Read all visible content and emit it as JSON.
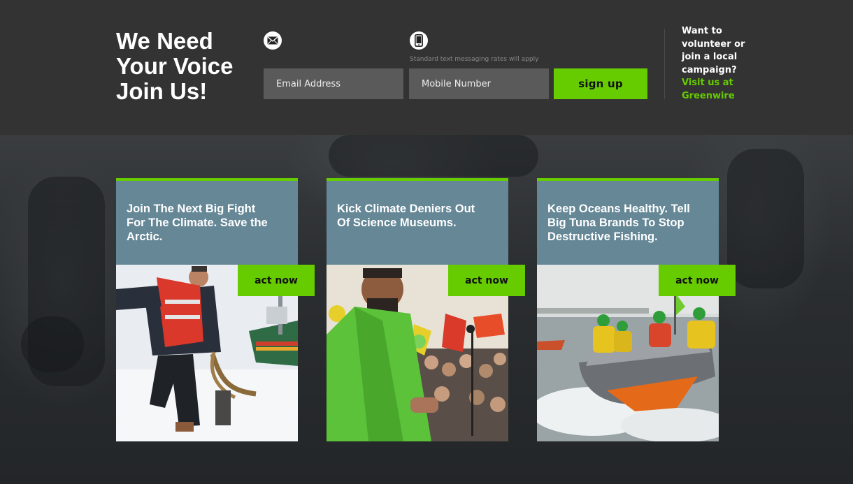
{
  "header": {
    "headline": [
      "We Need",
      "Your Voice",
      "Join Us!"
    ],
    "sms_note": "Standard text messaging rates will apply",
    "email_placeholder": "Email Address",
    "mobile_placeholder": "Mobile Number",
    "signup_label": "sign up",
    "email_icon": "envelope-icon",
    "phone_icon": "mobile-phone-icon"
  },
  "volunteer": {
    "lines": [
      "Want to",
      "volunteer or",
      "join a local",
      "campaign?"
    ],
    "link_lines": [
      "Visit us at",
      "Greenwire"
    ]
  },
  "cards": [
    {
      "title_lines": [
        "Join The Next Big Fight",
        "For The Climate. Save the",
        "Arctic."
      ],
      "cta": "act now",
      "image": "arctic-activist-on-ice-photo"
    },
    {
      "title_lines": [
        "Kick Climate Deniers Out",
        "Of Science Museums."
      ],
      "cta": "act now",
      "image": "speaker-at-climate-march-photo"
    },
    {
      "title_lines": [
        "Keep Oceans Healthy. Tell",
        "Big Tuna Brands To Stop",
        "Destructive Fishing."
      ],
      "cta": "act now",
      "image": "activists-in-inflatable-boat-photo"
    }
  ],
  "colors": {
    "accent": "#66cc00",
    "header_bg": "#333333",
    "card_head_bg": "#658796",
    "input_bg": "#5a5a5a"
  }
}
